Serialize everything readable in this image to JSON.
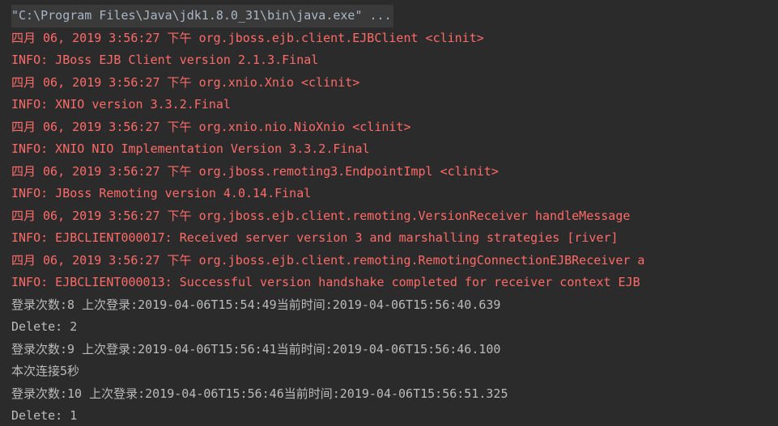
{
  "console": {
    "command_line": "\"C:\\Program Files\\Java\\jdk1.8.0_31\\bin\\java.exe\" ...",
    "lines": [
      {
        "type": "err",
        "text": "四月 06, 2019 3:56:27 下午 org.jboss.ejb.client.EJBClient <clinit>"
      },
      {
        "type": "err",
        "text": "INFO: JBoss EJB Client version 2.1.3.Final"
      },
      {
        "type": "err",
        "text": "四月 06, 2019 3:56:27 下午 org.xnio.Xnio <clinit>"
      },
      {
        "type": "err",
        "text": "INFO: XNIO version 3.3.2.Final"
      },
      {
        "type": "err",
        "text": "四月 06, 2019 3:56:27 下午 org.xnio.nio.NioXnio <clinit>"
      },
      {
        "type": "err",
        "text": "INFO: XNIO NIO Implementation Version 3.3.2.Final"
      },
      {
        "type": "err",
        "text": "四月 06, 2019 3:56:27 下午 org.jboss.remoting3.EndpointImpl <clinit>"
      },
      {
        "type": "err",
        "text": "INFO: JBoss Remoting version 4.0.14.Final"
      },
      {
        "type": "err",
        "text": "四月 06, 2019 3:56:27 下午 org.jboss.ejb.client.remoting.VersionReceiver handleMessage"
      },
      {
        "type": "err",
        "text": "INFO: EJBCLIENT000017: Received server version 3 and marshalling strategies [river]"
      },
      {
        "type": "err",
        "text": "四月 06, 2019 3:56:27 下午 org.jboss.ejb.client.remoting.RemotingConnectionEJBReceiver a"
      },
      {
        "type": "err",
        "text": "INFO: EJBCLIENT000013: Successful version handshake completed for receiver context EJB"
      },
      {
        "type": "out",
        "text": "登录次数:8 上次登录:2019-04-06T15:54:49当前时间:2019-04-06T15:56:40.639"
      },
      {
        "type": "out",
        "text": "Delete: 2"
      },
      {
        "type": "out",
        "text": "登录次数:9 上次登录:2019-04-06T15:56:41当前时间:2019-04-06T15:56:46.100"
      },
      {
        "type": "out",
        "text": "本次连接5秒"
      },
      {
        "type": "out",
        "text": "登录次数:10 上次登录:2019-04-06T15:56:46当前时间:2019-04-06T15:56:51.325"
      },
      {
        "type": "out",
        "text": "Delete: 1"
      }
    ]
  },
  "colors": {
    "background": "#2b2b2b",
    "stderr": "#ff6b68",
    "stdout": "#bbbbbb",
    "command": "#a9b7c6"
  }
}
